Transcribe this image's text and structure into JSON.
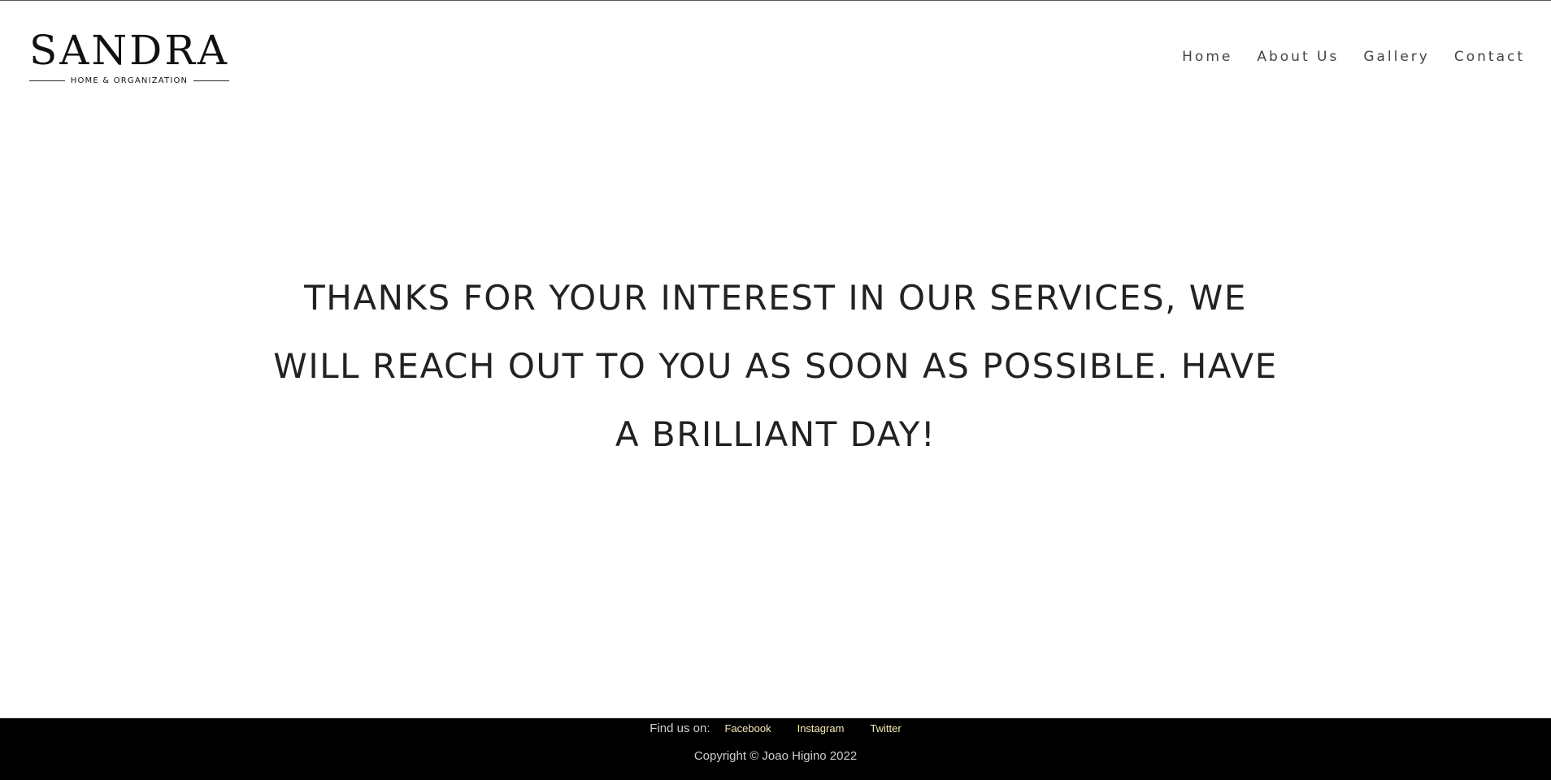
{
  "header": {
    "logo": {
      "name": "SANDRA",
      "tagline": "HOME & ORGANIZATION"
    },
    "nav": [
      {
        "label": "Home"
      },
      {
        "label": "About Us"
      },
      {
        "label": "Gallery"
      },
      {
        "label": "Contact"
      }
    ]
  },
  "main": {
    "message_lines": [
      "THANKS FOR YOUR INTEREST IN OUR SERVICES, WE",
      "WILL REACH OUT TO YOU AS SOON AS POSSIBLE. HAVE",
      "A BRILLIANT DAY!"
    ]
  },
  "footer": {
    "find_us_label": "Find us on:",
    "social_links": [
      {
        "label": "Facebook"
      },
      {
        "label": "Instagram"
      },
      {
        "label": "Twitter"
      }
    ],
    "copyright": "Copyright © Joao Higino 2022"
  },
  "colors": {
    "background": "#ffffff",
    "text": "#222222",
    "footer_background": "#000000",
    "footer_link": "#f5e9b8",
    "footer_text": "#cfcfcf"
  }
}
